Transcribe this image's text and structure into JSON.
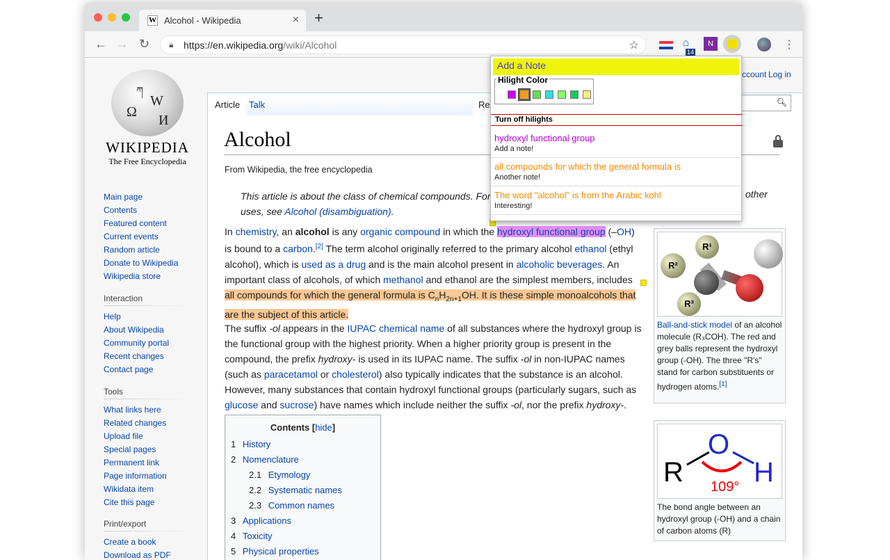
{
  "browser": {
    "tab_title": "Alcohol - Wikipedia",
    "tab_favicon": "W",
    "url_host": "https://en.wikipedia.org",
    "url_path": "/wiki/Alcohol",
    "ext_badge": "14"
  },
  "wiki": {
    "wordmark": "Wikipedia",
    "tagline": "The Free Encyclopedia",
    "nav_main": [
      "Main page",
      "Contents",
      "Featured content",
      "Current events",
      "Random article",
      "Donate to Wikipedia",
      "Wikipedia store"
    ],
    "interaction_heading": "Interaction",
    "nav_interaction": [
      "Help",
      "About Wikipedia",
      "Community portal",
      "Recent changes",
      "Contact page"
    ],
    "tools_heading": "Tools",
    "nav_tools": [
      "What links here",
      "Related changes",
      "Upload file",
      "Special pages",
      "Permanent link",
      "Page information",
      "Wikidata item",
      "Cite this page"
    ],
    "print_heading": "Print/export",
    "nav_print": [
      "Create a book",
      "Download as PDF"
    ],
    "tab_article": "Article",
    "tab_talk": "Talk",
    "tab_read": "Re",
    "account": "ccount",
    "login": "Log in",
    "title": "Alcohol",
    "from": "From Wikipedia, the free encyclopedia",
    "hatnote_start": "This article is about the class of chemical compounds. For",
    "hatnote_end": "other",
    "hatnote_line2_pre": "uses, see ",
    "hatnote_link": "Alcohol (disambiguation)",
    "hatnote_line2_post": ".",
    "toc_title": "Contents",
    "toc_hide": "hide",
    "toc": [
      {
        "num": "1",
        "label": "History",
        "sub": false
      },
      {
        "num": "2",
        "label": "Nomenclature",
        "sub": false
      },
      {
        "num": "2.1",
        "label": "Etymology",
        "sub": true
      },
      {
        "num": "2.2",
        "label": "Systematic names",
        "sub": true
      },
      {
        "num": "2.3",
        "label": "Common names",
        "sub": true
      },
      {
        "num": "3",
        "label": "Applications",
        "sub": false
      },
      {
        "num": "4",
        "label": "Toxicity",
        "sub": false
      },
      {
        "num": "5",
        "label": "Physical properties",
        "sub": false
      }
    ],
    "infobox1_caption_link": "Ball-and-stick model",
    "infobox1_caption": " of an alcohol molecule (R₃COH). The red and grey balls represent the hydroxyl group (-OH). The three \"R's\" stand for carbon substituents or hydrogen atoms.",
    "infobox1_ref": "[1]",
    "infobox1_labels": [
      "R¹",
      "R²",
      "R³"
    ],
    "infobox2_caption": "The bond angle between an hydroxyl group (-OH) and a chain of carbon atoms (R)",
    "infobox2_labels": {
      "r": "R",
      "o": "O",
      "h": "H",
      "angle": "109°"
    }
  },
  "popup": {
    "title": "Add a Note",
    "color_legend": "Hilight Color",
    "colors": [
      "#cc00ee",
      "#f39c1a",
      "#66dd55",
      "#33dddd",
      "#88ff66",
      "#11cc66",
      "#ffee77"
    ],
    "turn_off": "Turn off hilights",
    "notes": [
      {
        "text": "hydroxyl functional group",
        "note": "Add a note!",
        "color": "#b000d0"
      },
      {
        "text": "all compounds for which the general formula is",
        "note": "Another note!",
        "color": "#f08a00"
      },
      {
        "text": "The word \"alcohol\" is from the Arabic kohl",
        "note": "Interesting!",
        "color": "#f08a00"
      }
    ]
  }
}
